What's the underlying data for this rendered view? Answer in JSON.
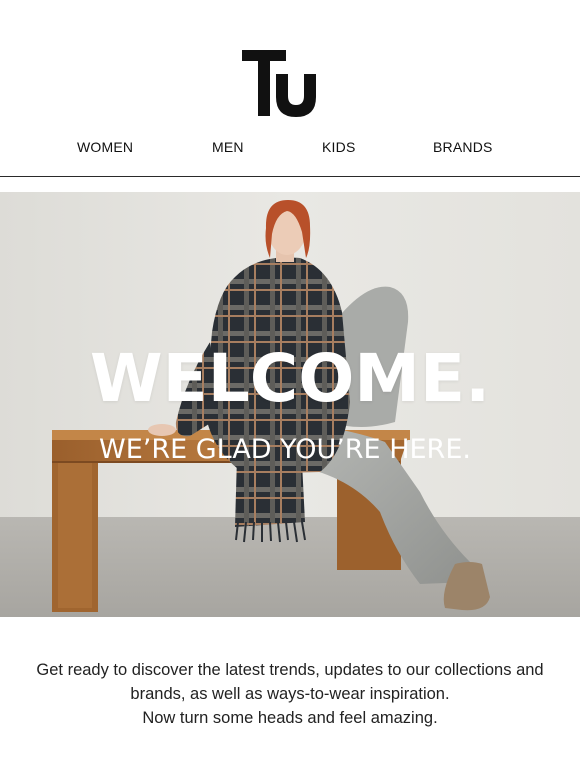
{
  "brand": {
    "logo_text": "Tu",
    "logo_color": "#111111"
  },
  "nav": {
    "items": [
      {
        "label": "WOMEN"
      },
      {
        "label": "MEN"
      },
      {
        "label": "KIDS"
      },
      {
        "label": "BRANDS"
      }
    ]
  },
  "hero": {
    "title": "WELCOME.",
    "subtitle": "WE’RE GLAD YOU’RE HERE.",
    "text_color": "#ffffff"
  },
  "intro": {
    "lines": [
      "Get ready to discover the latest trends, updates to our collections and",
      "brands, as well as ways-to-wear inspiration.",
      "Now turn some heads and feel amazing."
    ],
    "text_color": "#222222"
  },
  "icons": {
    "logo": "tu-logo-icon"
  }
}
